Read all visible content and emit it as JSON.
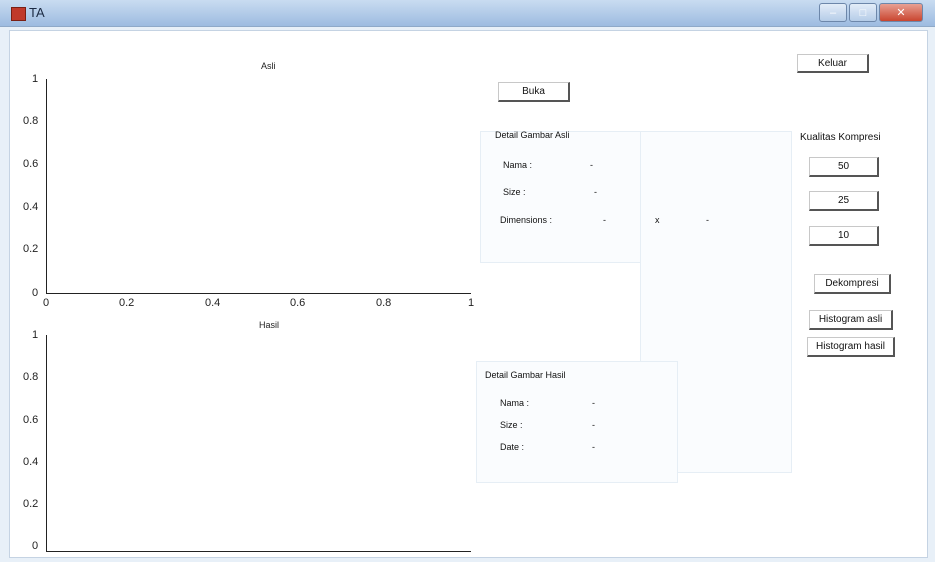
{
  "window": {
    "title": "TA"
  },
  "axes_top": {
    "title": "Asli",
    "y_ticks": [
      "1",
      "0.8",
      "0.6",
      "0.4",
      "0.2",
      "0"
    ],
    "x_ticks": [
      "0",
      "0.2",
      "0.4",
      "0.6",
      "0.8",
      "1"
    ]
  },
  "axes_bottom": {
    "title": "Hasil",
    "y_ticks": [
      "1",
      "0.8",
      "0.6",
      "0.4",
      "0.2",
      "0"
    ]
  },
  "buttons": {
    "keluar": "Keluar",
    "buka": "Buka",
    "q50": "50",
    "q25": "25",
    "q10": "10",
    "dekompresi": "Dekompresi",
    "hist_asli": "Histogram asli",
    "hist_hasil": "Histogram hasil"
  },
  "kualitas_label": "Kualitas Kompresi",
  "detail_asli": {
    "heading": "Detail Gambar Asli",
    "nama_label": "Nama :",
    "nama_value": "-",
    "size_label": "Size :",
    "size_value": "-",
    "dim_label": "Dimensions :",
    "dim_w": "-",
    "dim_x": "x",
    "dim_h": "-"
  },
  "detail_hasil": {
    "heading": "Detail Gambar Hasil",
    "nama_label": "Nama :",
    "nama_value": "-",
    "size_label": "Size :",
    "size_value": "-",
    "date_label": "Date :",
    "date_value": "-"
  }
}
